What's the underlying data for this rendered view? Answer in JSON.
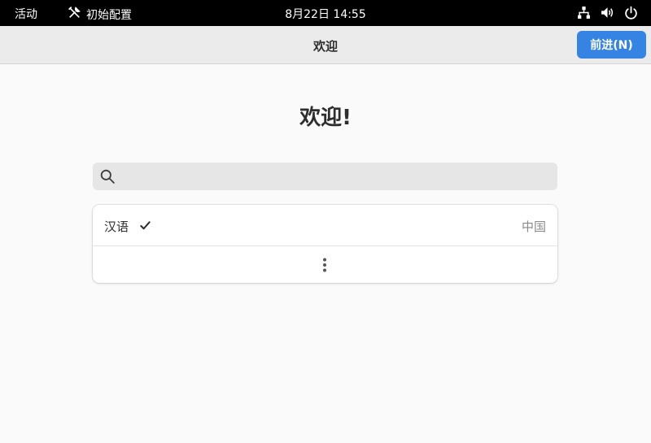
{
  "topbar": {
    "activities": "活动",
    "app_name": "初始配置",
    "clock": "8月22日  14:55"
  },
  "header": {
    "title": "欢迎",
    "next_label": "前进(N)"
  },
  "main": {
    "heading": "欢迎!",
    "search_value": "",
    "languages": [
      {
        "name": "汉语",
        "region": "中国",
        "selected": true
      }
    ]
  },
  "colors": {
    "accent": "#3584e4",
    "topbar": "#000000",
    "background": "#fafafa"
  }
}
